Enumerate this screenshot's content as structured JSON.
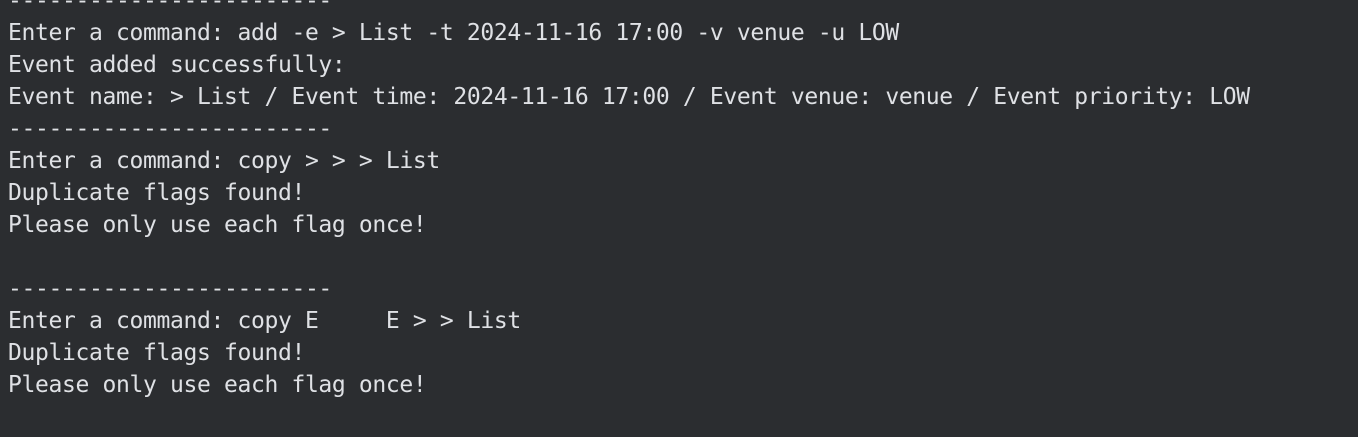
{
  "terminal": {
    "lines": [
      "------------------------",
      "Enter a command: add -e > List -t 2024-11-16 17:00 -v venue -u LOW",
      "Event added successfully:",
      "Event name: > List / Event time: 2024-11-16 17:00 / Event venue: venue / Event priority: LOW",
      "------------------------",
      "Enter a command: copy > > > List",
      "Duplicate flags found!",
      "Please only use each flag once!",
      "",
      "------------------------",
      "Enter a command: copy E     E > > List",
      "Duplicate flags found!",
      "Please only use each flag once!",
      ""
    ]
  },
  "colors": {
    "background": "#2b2d30",
    "text": "#dfe1e5"
  }
}
